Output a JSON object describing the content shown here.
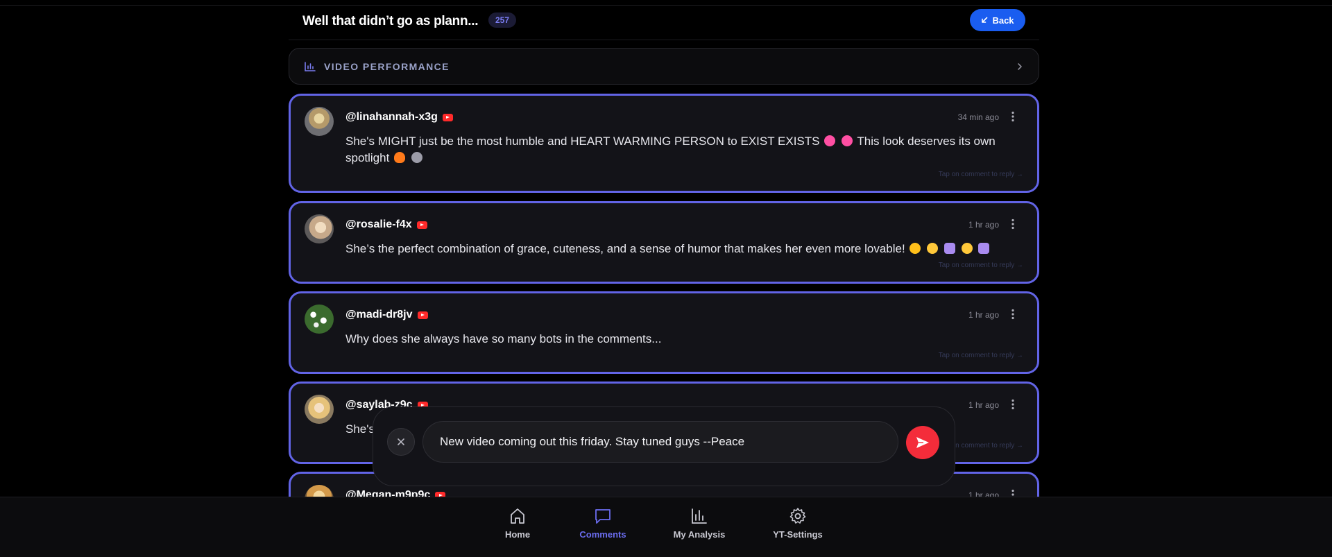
{
  "header": {
    "title": "Well that didn’t go as plann...",
    "count": "257",
    "back_label": "Back"
  },
  "performance": {
    "label": "VIDEO PERFORMANCE"
  },
  "comments": [
    {
      "author": "@linahannah-x3g",
      "time": "34 min ago",
      "text": "She's MIGHT just be the most humble and HEART WARMING PERSON to EXIST EXISTS",
      "text_after": "This look deserves its own spotlight",
      "hint": "Tap on comment to reply →"
    },
    {
      "author": "@rosalie-f4x",
      "time": "1 hr ago",
      "text": "She’s the perfect combination of grace, cuteness, and a sense of humor that makes her even more lovable!",
      "hint": "Tap on comment to reply →"
    },
    {
      "author": "@madi-dr8jv",
      "time": "1 hr ago",
      "text": "Why does she always have so many bots in the comments...",
      "hint": "Tap on comment to reply →"
    },
    {
      "author": "@saylab-z9c",
      "time": "1 hr ago",
      "text": "She's",
      "hint": "Tap on comment to reply →"
    },
    {
      "author": "@Megan-m9p9c",
      "time": "1 hr ago"
    }
  ],
  "composer": {
    "value": "New video coming out this friday. Stay tuned guys --Peace"
  },
  "nav": {
    "home": "Home",
    "comments": "Comments",
    "analysis": "My Analysis",
    "settings": "YT-Settings"
  },
  "colors": {
    "accent": "#6264e6",
    "back_button": "#1a5df0",
    "send_button": "#f42c3a",
    "youtube_badge": "#ff2a2a"
  }
}
